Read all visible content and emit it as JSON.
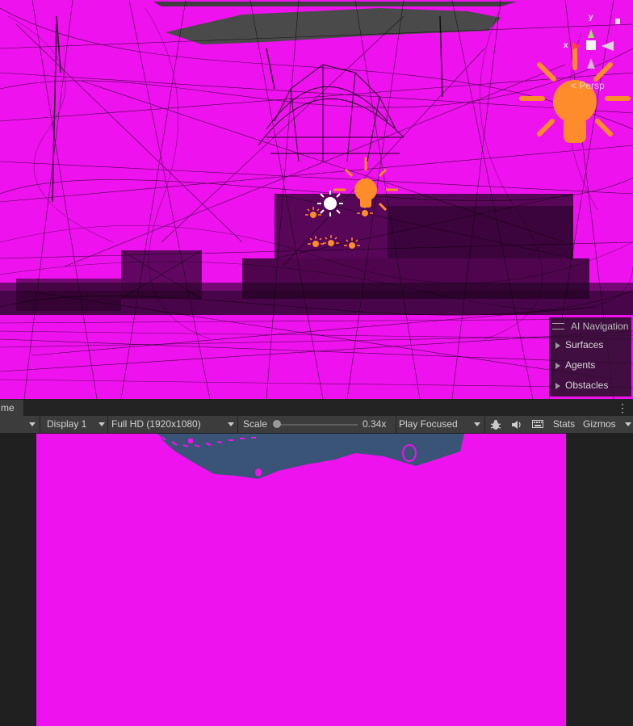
{
  "scene_view": {
    "gizmo": {
      "y_label": "y",
      "x_label": "x",
      "projection_label": "< Persp"
    },
    "lights": [
      "directional-light",
      "point-light",
      "point-light",
      "point-light",
      "point-light",
      "point-light",
      "point-light"
    ],
    "colors": {
      "missing_material": "#ee12ee",
      "wireframe": "#000000",
      "light_icon": "#ff8c2a"
    }
  },
  "ai_navigation": {
    "title": "AI Navigation",
    "items": [
      "Surfaces",
      "Agents",
      "Obstacles"
    ]
  },
  "game_view": {
    "tab_label": "me",
    "toolbar": {
      "display": "Display 1",
      "resolution": "Full HD (1920x1080)",
      "scale_label": "Scale",
      "scale_value": "0.34x",
      "play_mode": "Play Focused",
      "stats_label": "Stats",
      "gizmos_label": "Gizmos"
    }
  }
}
